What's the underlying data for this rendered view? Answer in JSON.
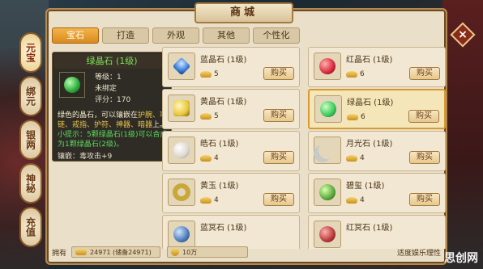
{
  "title": "商城",
  "side_tabs": [
    "元宝",
    "绑元",
    "银两",
    "神秘",
    "充值"
  ],
  "top_tabs": [
    "宝石",
    "打造",
    "外观",
    "其他",
    "个性化"
  ],
  "close_label": "×",
  "tooltip": {
    "title": "绿晶石 (1级)",
    "level": "等级：1",
    "bind": "未绑定",
    "score": "评分：170",
    "desc_1": "绿色的晶石，可以镶嵌在",
    "desc_2": "护腕、项链",
    "desc_3": "、戒指、护符、神器、暗器",
    "desc_4": "上。",
    "tip": "小提示：5颗绿晶石(1级)可以合成为1颗绿晶石(2级)。",
    "effect": "镶嵌：毒攻击+9"
  },
  "items": [
    {
      "name": "蓝晶石 (1级)",
      "price": "5",
      "buy": "购买",
      "color": "#3a7cd8"
    },
    {
      "name": "红晶石 (1级)",
      "price": "6",
      "buy": "购买",
      "color": "#d8283a"
    },
    {
      "name": "黄晶石 (1级)",
      "price": "5",
      "buy": "购买",
      "color": "#e8c83a"
    },
    {
      "name": "绿晶石 (1级)",
      "price": "6",
      "buy": "购买",
      "color": "#3ac85a"
    },
    {
      "name": "皓石 (1级)",
      "price": "4",
      "buy": "购买",
      "color": "#dcd8d0"
    },
    {
      "name": "月光石 (1级)",
      "price": "4",
      "buy": "购买",
      "color": "#c8cac8"
    },
    {
      "name": "黄玉 (1级)",
      "price": "4",
      "buy": "购买",
      "color": "#c8a83a"
    },
    {
      "name": "碧玺 (1级)",
      "price": "4",
      "buy": "购买",
      "color": "#5aa83a"
    },
    {
      "name": "蓝冥石 (1级)",
      "price": "",
      "buy": "",
      "color": "#4a7ab8"
    },
    {
      "name": "红冥石 (1级)",
      "price": "",
      "buy": "",
      "color": "#b83a3a"
    }
  ],
  "bottom": {
    "own_label": "拥有",
    "own_value": "24971 (储备24971)",
    "coin_value": "10万",
    "right_text": "适度娱乐理性"
  },
  "watermark": "思创网"
}
